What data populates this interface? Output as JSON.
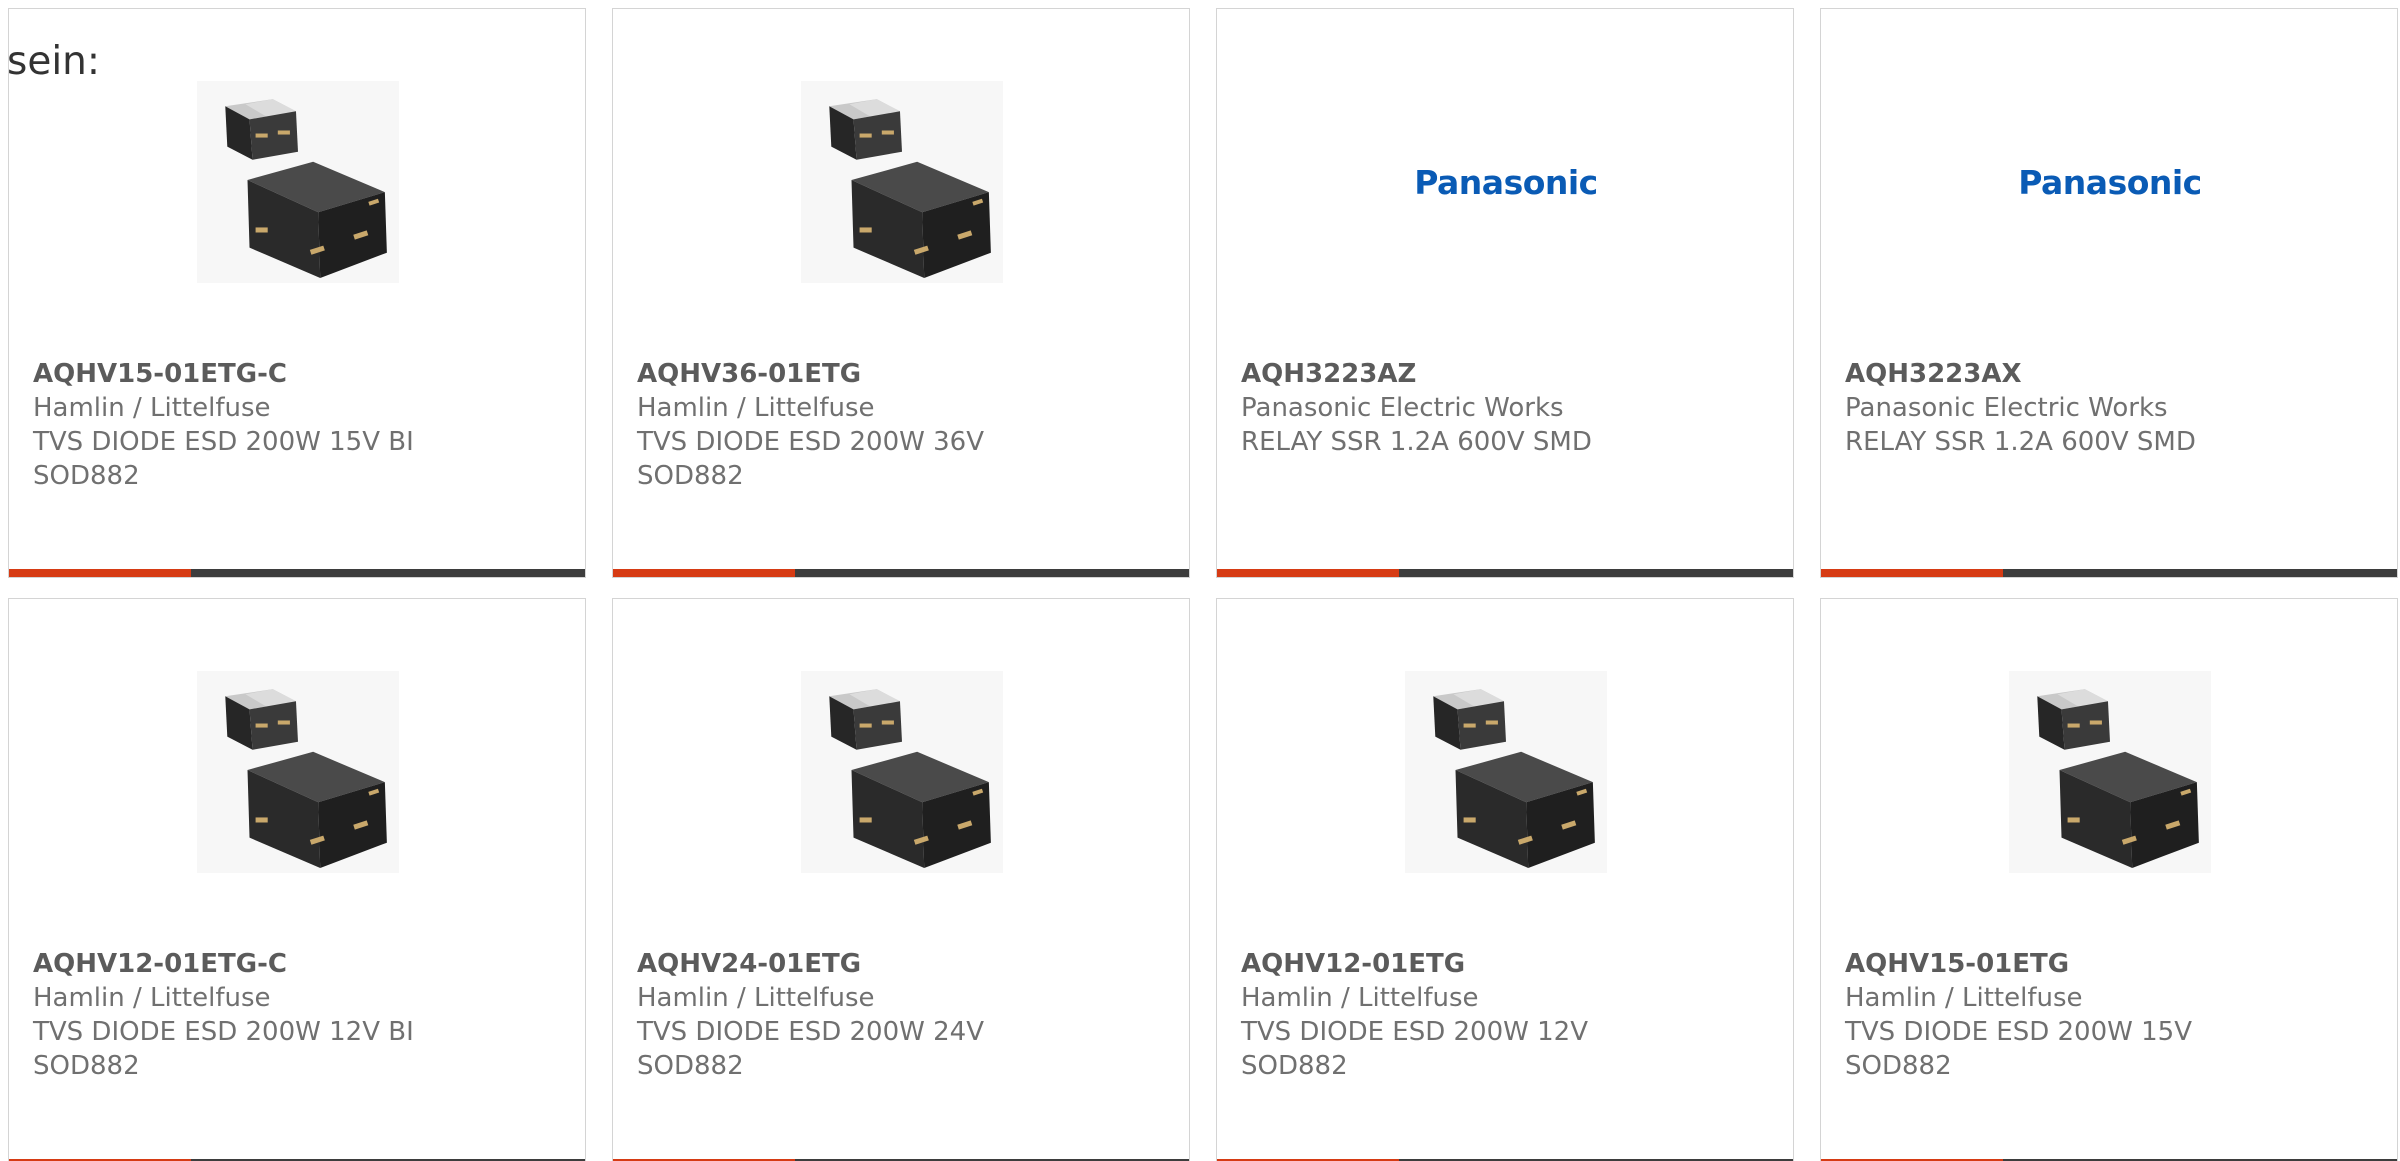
{
  "intro_text": "sein:",
  "colors": {
    "accent": "#d63b14",
    "bar": "#3d3d3d",
    "card_border": "#d4d4d4",
    "panasonic_blue": "#0a5bb5"
  },
  "products": [
    {
      "part_number": "AQHV15-01ETG-C",
      "manufacturer": "Hamlin / Littelfuse",
      "description": [
        "TVS DIODE ESD 200W 15V BI",
        "SOD882"
      ],
      "image": "sod882-package-image"
    },
    {
      "part_number": "AQHV36-01ETG",
      "manufacturer": "Hamlin / Littelfuse",
      "description": [
        "TVS DIODE ESD 200W 36V",
        "SOD882"
      ],
      "image": "sod882-package-image"
    },
    {
      "part_number": "AQH3223AZ",
      "manufacturer": "Panasonic Electric Works",
      "description": [
        "RELAY SSR 1.2A 600V SMD"
      ],
      "image": "panasonic-logo",
      "logo_text": "Panasonic"
    },
    {
      "part_number": "AQH3223AX",
      "manufacturer": "Panasonic Electric Works",
      "description": [
        "RELAY SSR 1.2A 600V SMD"
      ],
      "image": "panasonic-logo",
      "logo_text": "Panasonic"
    },
    {
      "part_number": "AQHV12-01ETG-C",
      "manufacturer": "Hamlin / Littelfuse",
      "description": [
        "TVS DIODE ESD 200W 12V BI",
        "SOD882"
      ],
      "image": "sod882-package-image"
    },
    {
      "part_number": "AQHV24-01ETG",
      "manufacturer": "Hamlin / Littelfuse",
      "description": [
        "TVS DIODE ESD 200W 24V",
        "SOD882"
      ],
      "image": "sod882-package-image"
    },
    {
      "part_number": "AQHV12-01ETG",
      "manufacturer": "Hamlin / Littelfuse",
      "description": [
        "TVS DIODE ESD 200W 12V",
        "SOD882"
      ],
      "image": "sod882-package-image"
    },
    {
      "part_number": "AQHV15-01ETG",
      "manufacturer": "Hamlin / Littelfuse",
      "description": [
        "TVS DIODE ESD 200W 15V",
        "SOD882"
      ],
      "image": "sod882-package-image"
    }
  ]
}
